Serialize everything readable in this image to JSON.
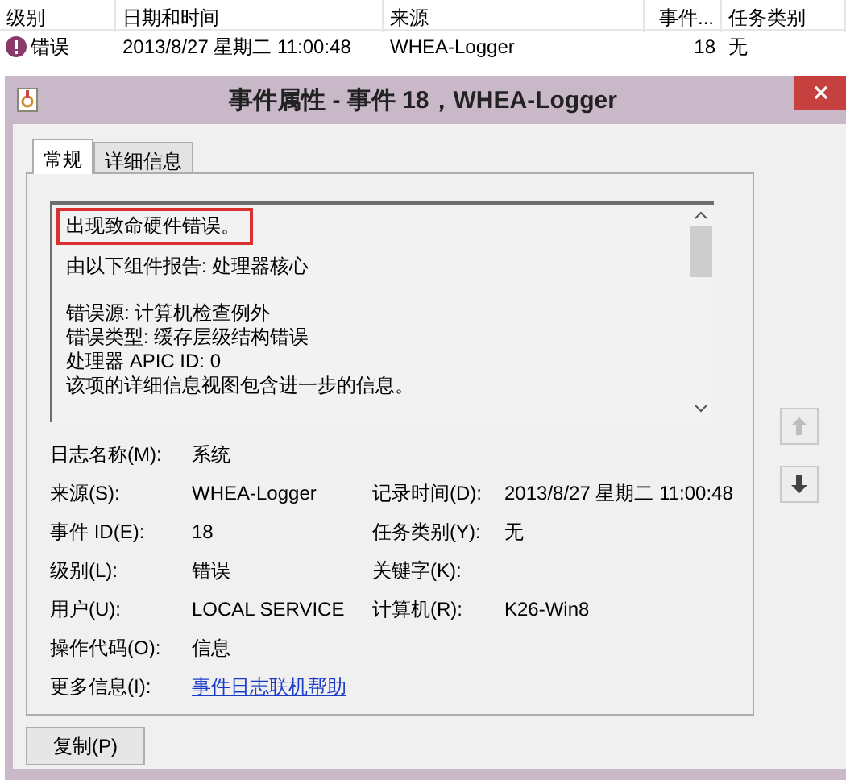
{
  "event_list": {
    "columns": [
      "级别",
      "日期和时间",
      "来源",
      "事件...",
      "任务类别"
    ],
    "rows": [
      {
        "kind": "error",
        "cells": [
          "错误",
          "2013/8/27 星期二 11:00:48",
          "WHEA-Logger",
          "18",
          "无"
        ]
      }
    ]
  },
  "dialog": {
    "title": "事件属性 - 事件 18，WHEA-Logger",
    "tabs": [
      {
        "label": "常规",
        "selected": true
      },
      {
        "label": "详细信息",
        "selected": false
      }
    ],
    "message": [
      {
        "highlighted": true,
        "lines": [
          "出现致命硬件错误。"
        ]
      },
      {
        "highlighted": false,
        "lines": [
          "由以下组件报告: 处理器核心"
        ]
      },
      {
        "highlighted": false,
        "lines": [
          "错误源: 计算机检查例外",
          "错误类型: 缓存层级结构错误",
          "处理器 APIC ID: 0",
          "该项的详细信息视图包含进一步的信息。"
        ]
      }
    ],
    "fields": [
      [
        {
          "kind": "text",
          "label": "日志名称(M):",
          "value": "系统"
        }
      ],
      [
        {
          "kind": "text",
          "label": "来源(S):",
          "value": "WHEA-Logger"
        },
        {
          "kind": "text",
          "label": "记录时间(D):",
          "value": "2013/8/27 星期二 11:00:48"
        }
      ],
      [
        {
          "kind": "text",
          "label": "事件 ID(E):",
          "value": "18"
        },
        {
          "kind": "text",
          "label": "任务类别(Y):",
          "value": "无"
        }
      ],
      [
        {
          "kind": "text",
          "label": "级别(L):",
          "value": "错误"
        },
        {
          "kind": "text",
          "label": "关键字(K):"
        }
      ],
      [
        {
          "kind": "text",
          "label": "用户(U):",
          "value": "LOCAL SERVICE"
        },
        {
          "kind": "text",
          "label": "计算机(R):",
          "value": "K26-Win8"
        }
      ],
      [
        {
          "kind": "text",
          "label": "操作代码(O):",
          "value": "信息"
        }
      ],
      [
        {
          "kind": "link",
          "label": "更多信息(I):",
          "value": "事件日志联机帮助"
        }
      ]
    ],
    "nav": [
      {
        "kind": "up",
        "disabled": true
      },
      {
        "kind": "down",
        "disabled": false
      }
    ],
    "buttons": [
      "复制(P)"
    ]
  }
}
